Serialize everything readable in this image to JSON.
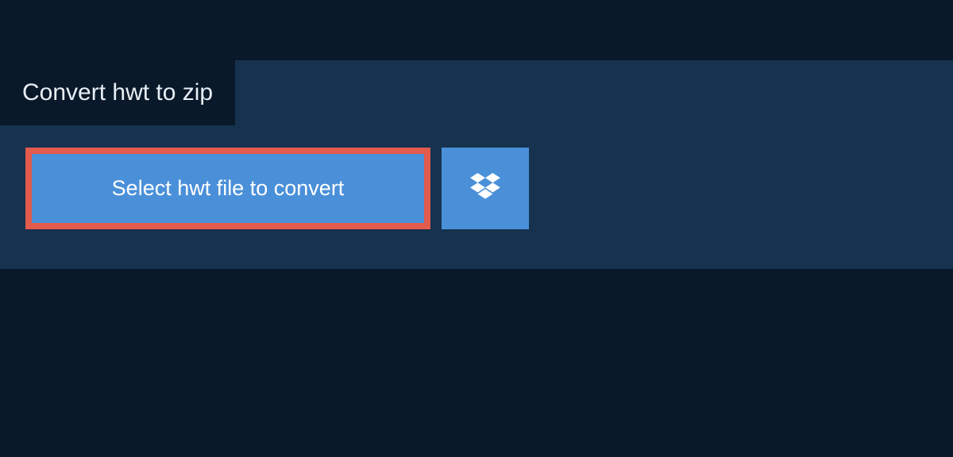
{
  "tab": {
    "title": "Convert hwt to zip"
  },
  "buttons": {
    "select_file": "Select hwt file to convert",
    "dropbox_icon": "dropbox-icon"
  },
  "colors": {
    "page_bg": "#0a1929",
    "panel_bg": "#16324f",
    "button_bg": "#4a90d9",
    "button_border": "#e25b4c",
    "text_light": "#ffffff"
  }
}
